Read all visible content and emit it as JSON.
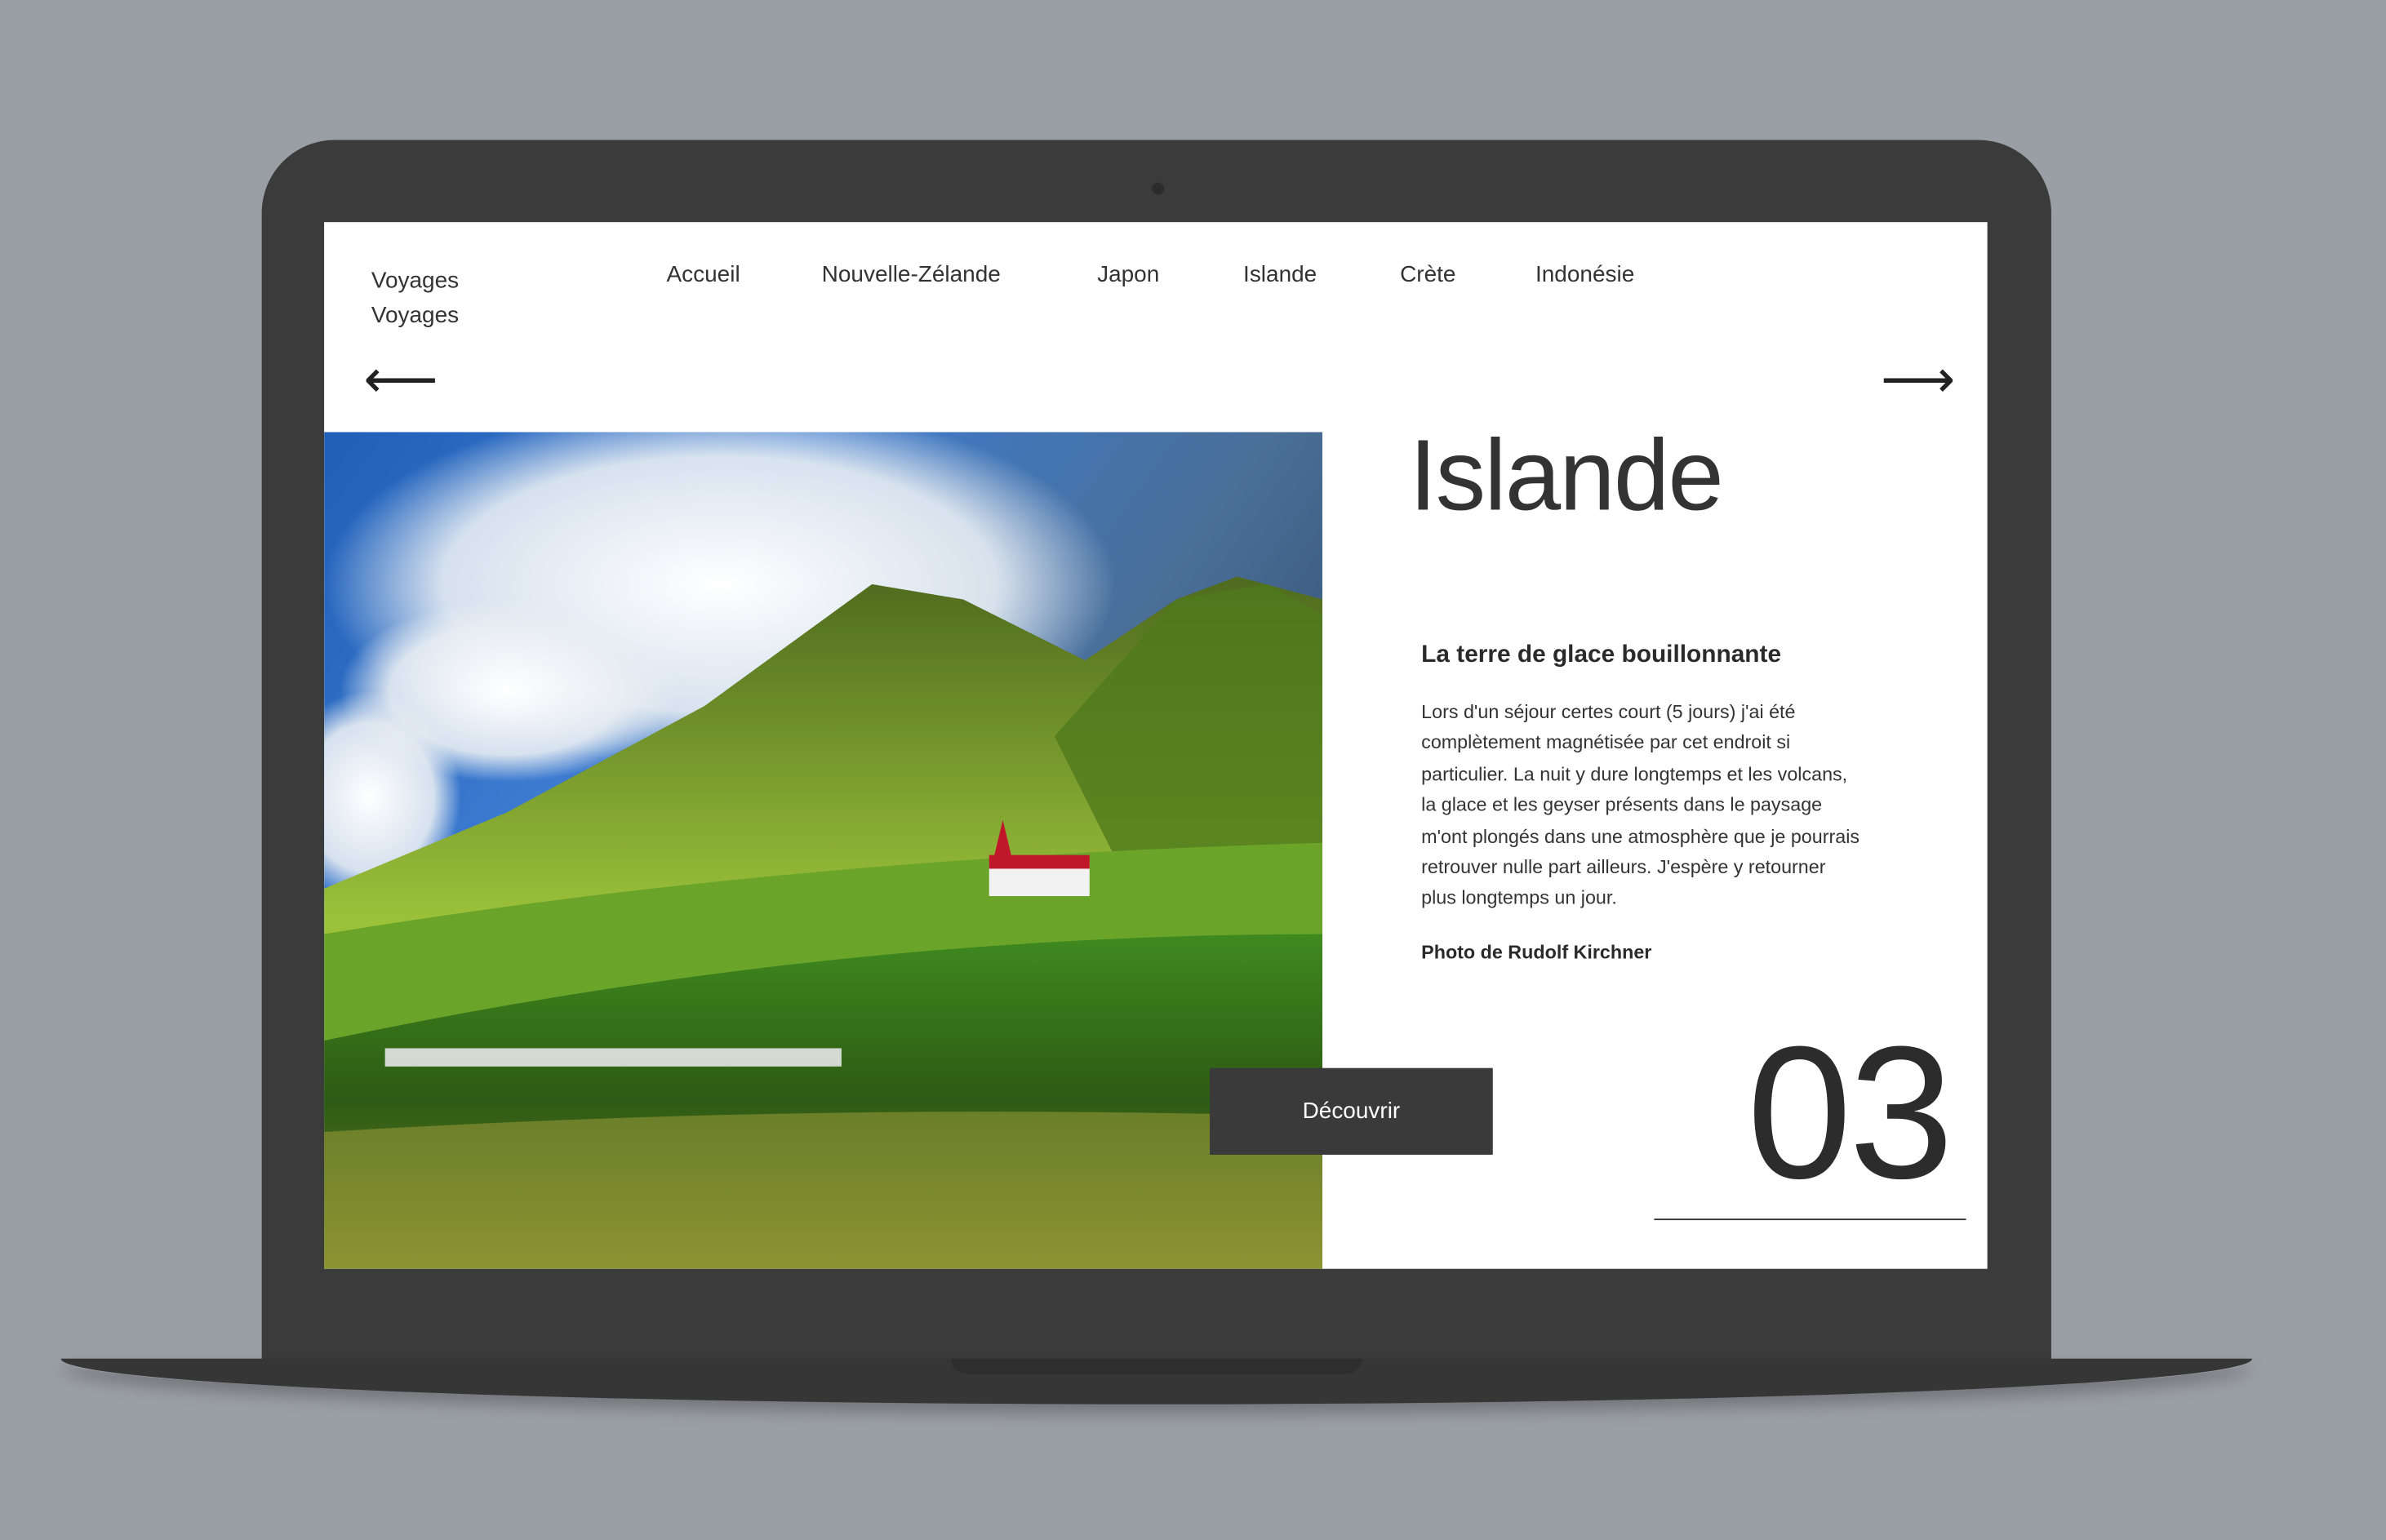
{
  "header": {
    "brand_line1": "Voyages",
    "brand_line2": "Voyages"
  },
  "nav": [
    {
      "label": "Accueil"
    },
    {
      "label": "Nouvelle-Zélande"
    },
    {
      "label": "Japon"
    },
    {
      "label": "Islande"
    },
    {
      "label": "Crète"
    },
    {
      "label": "Indonésie"
    }
  ],
  "controls": {
    "prev_icon": "arrow-left-icon",
    "next_icon": "arrow-right-icon",
    "prev": "⟵",
    "next": "⟶"
  },
  "slide": {
    "title": "Islande",
    "subtitle": "La terre de glace bouillonnante",
    "description": "Lors d'un séjour certes court (5 jours) j'ai été complètement magnétisée par cet endroit si particulier. La nuit y dure longtemps et les volcans, la glace et les geyser présents dans le paysage m'ont plongés dans une atmosphère que je pourrais retrouver nulle part ailleurs. J'espère y retourner plus longtemps un jour.",
    "credit": "Photo de Rudolf Kirchner",
    "cta": "Découvrir",
    "number": "03"
  },
  "colors": {
    "background": "#9a9ea5",
    "laptop": "#3b3b3b",
    "button": "#3a3a3a"
  }
}
